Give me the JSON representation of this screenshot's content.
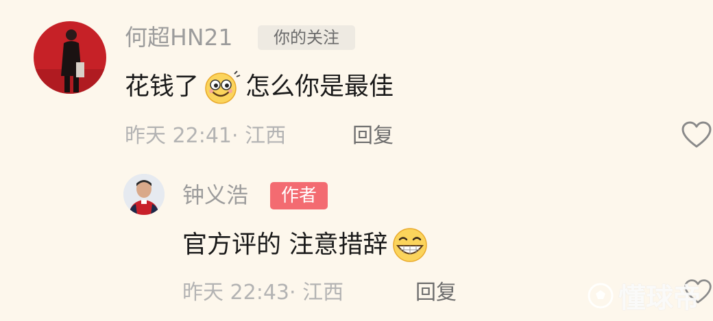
{
  "comments": [
    {
      "username": "何超HN21",
      "badge": "你的关注",
      "text_before": "花钱了",
      "emoji": "smile-emoji",
      "text_after": " 怎么你是最佳",
      "time": "昨天 22:41",
      "location": "江西",
      "reply_label": "回复"
    },
    {
      "username": "钟义浩",
      "badge": "作者",
      "text_before": "官方评的 注意措辞",
      "emoji": "grin-emoji",
      "text_after": "",
      "time": "昨天 22:43",
      "location": "江西",
      "reply_label": "回复"
    }
  ],
  "watermark": "懂球帝",
  "colors": {
    "background": "#fdf7ec",
    "author_badge": "#f36b71",
    "follow_badge": "#eeeae2"
  }
}
